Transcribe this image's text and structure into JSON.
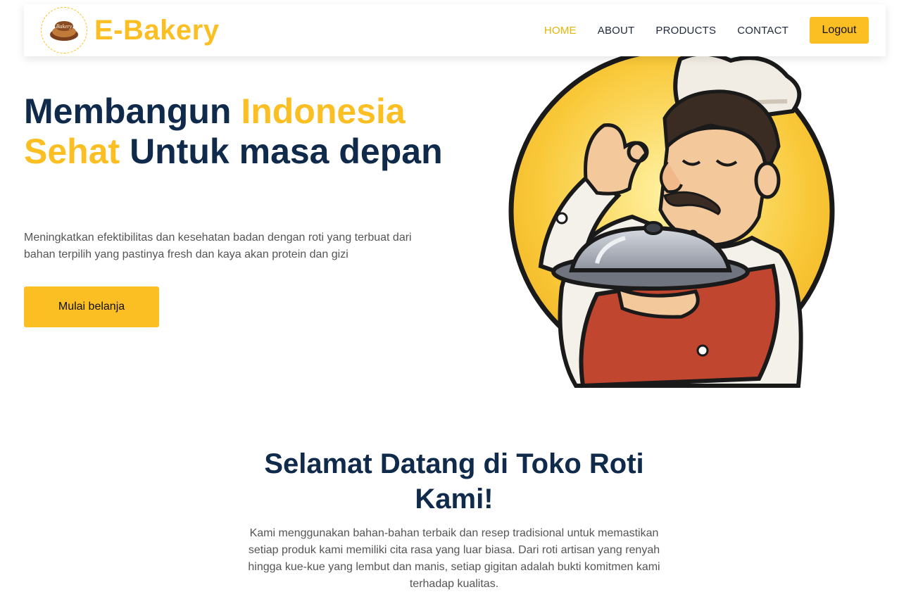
{
  "navbar": {
    "brand": "E-Bakery",
    "logo_icon": "bakery-logo-icon",
    "links": [
      "HOME",
      "ABOUT",
      "PRODUCTS",
      "CONTACT"
    ],
    "active_link": "HOME",
    "logout_label": "Logout"
  },
  "hero": {
    "title_part1": "Membangun ",
    "title_highlight1": "Indonesia Sehat",
    "title_part2": " Untuk masa depan",
    "subtitle": "Meningkatkan efektibilitas dan kesehatan badan dengan roti yang terbuat dari bahan terpilih yang pastinya fresh dan kaya akan protein dan gizi",
    "cta_label": "Mulai belanja",
    "illustration": "chef-illustration"
  },
  "welcome": {
    "title": "Selamat Datang di Toko Roti Kami!",
    "text": "Kami menggunakan bahan-bahan terbaik dan resep tradisional untuk memastikan setiap produk kami memiliki cita rasa yang luar biasa. Dari roti artisan yang renyah hingga kue-kue yang lembut dan manis, setiap gigitan adalah bukti komitmen kami terhadap kualitas."
  },
  "colors": {
    "accent": "#fbbf24",
    "heading": "#0f2a4a",
    "body_text": "#555555"
  }
}
